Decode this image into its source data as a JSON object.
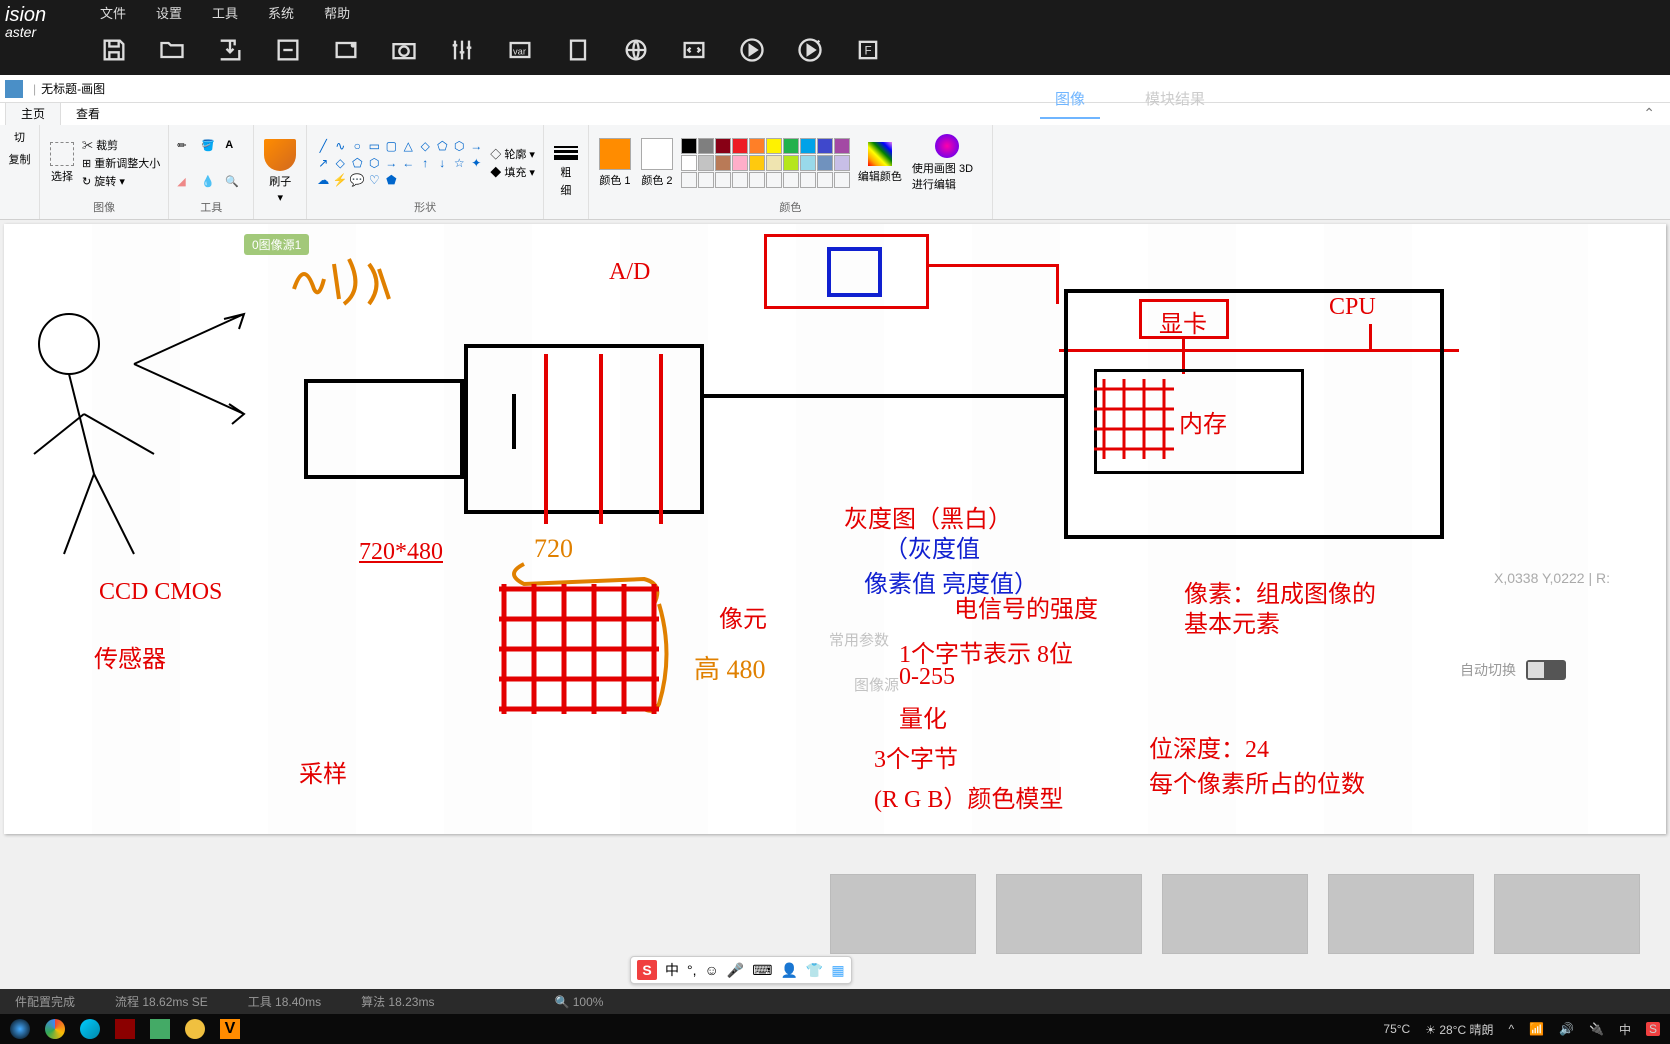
{
  "app_logo": {
    "line1": "ision",
    "line2": "aster"
  },
  "menubar": {
    "file": "文件",
    "settings": "设置",
    "tools": "工具",
    "system": "系统",
    "help": "帮助"
  },
  "paint_title": {
    "untitled": "无标题",
    "app": "画图"
  },
  "paint_tabs": {
    "home": "主页",
    "view": "查看"
  },
  "bg_tabs": {
    "image": "图像",
    "module_result": "模块结果"
  },
  "ribbon": {
    "clipboard": {
      "cut": "切",
      "copy": "复制"
    },
    "image": {
      "select": "选择",
      "crop": "裁剪",
      "resize": "重新调整大小",
      "rotate": "旋转",
      "label": "图像"
    },
    "tools": {
      "label": "工具"
    },
    "brushes": {
      "brush": "刷子",
      "label": ""
    },
    "shapes": {
      "outline": "轮廓",
      "fill": "填充",
      "label": "形状"
    },
    "thickness": {
      "label_top": "粗",
      "label_bot": "细"
    },
    "colors": {
      "c1": "颜色 1",
      "c2": "颜色 2",
      "edit": "编辑颜色",
      "paint3d": "使用画图 3D 进行编辑",
      "label": "颜色"
    }
  },
  "canvas": {
    "image_source_node": "0图像源1",
    "ad": "A/D",
    "resolution": "720*480",
    "ccd_cmos": "CCD  CMOS",
    "sensor": "传感器",
    "sampling": "采样",
    "pixel_element": "像元",
    "gpu": "显卡",
    "cpu": "CPU",
    "memory": "内存",
    "grayscale": "灰度图（黑白）",
    "gray_value": "（灰度值",
    "pixel_brightness": "像素值 亮度值）",
    "signal_strength": "电信号的强度",
    "pixel_def": "像素：组成图像的",
    "pixel_def2": "基本元素",
    "byte_8bit": "1个字节表示   8位",
    "range": "0-255",
    "quantize": "量化",
    "three_bytes": "3个字节",
    "rgb_model": "(R   G   B）颜色模型",
    "bit_depth": "位深度：24",
    "per_pixel_bits": "每个像素所占的位数",
    "handwritten_720": "720",
    "handwritten_480": "高 480"
  },
  "bg_panel": {
    "common_params": "常用参数",
    "image_source": "图像源",
    "auto_switch": "自动切换"
  },
  "coords": "X,0338  Y,0222  |  R:",
  "status": {
    "done": "件配置完成",
    "proc": "流程 18.62ms  SE",
    "tool": "工具  18.40ms",
    "alg": "算法 18.23ms",
    "zoom": "100%"
  },
  "ime": {
    "lang": "中"
  },
  "taskbar": {
    "cpu_temp": "75°C",
    "weather": "28°C 晴朗"
  }
}
